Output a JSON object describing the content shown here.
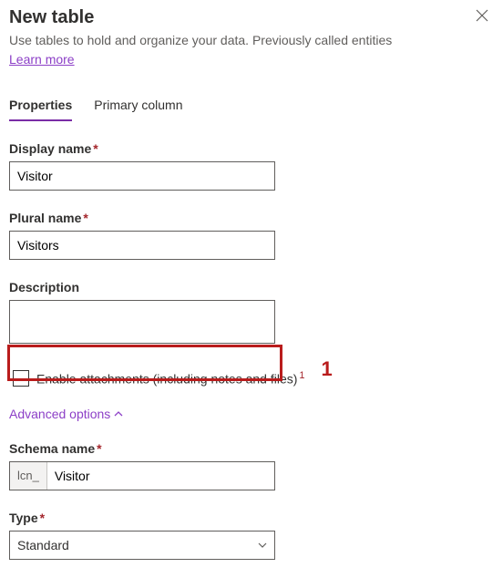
{
  "header": {
    "title": "New table",
    "subtitle": "Use tables to hold and organize your data. Previously called entities",
    "learn_more": "Learn more"
  },
  "tabs": {
    "properties": "Properties",
    "primary_column": "Primary column"
  },
  "fields": {
    "display_name": {
      "label": "Display name",
      "value": "Visitor"
    },
    "plural_name": {
      "label": "Plural name",
      "value": "Visitors"
    },
    "description": {
      "label": "Description",
      "value": ""
    },
    "enable_attachments": {
      "label": "Enable attachments (including notes and files)"
    },
    "advanced_options": "Advanced options",
    "schema_name": {
      "label": "Schema name",
      "prefix": "lcn_",
      "value": "Visitor"
    },
    "type": {
      "label": "Type",
      "value": "Standard"
    }
  },
  "callout": {
    "number": "1"
  }
}
